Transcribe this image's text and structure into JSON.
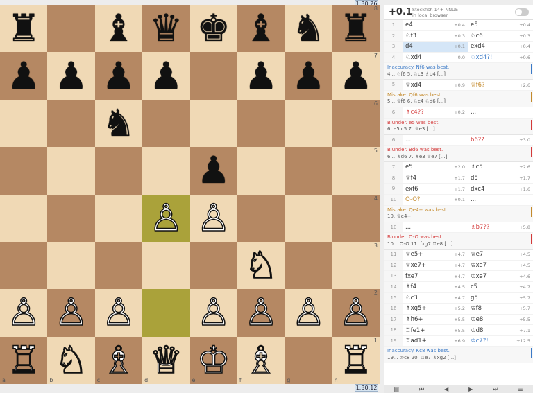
{
  "clocks": {
    "top": "1:30:26",
    "bottom": "1:30:12"
  },
  "board": {
    "rows": [
      [
        "♜",
        "",
        "♝",
        "♛",
        "♚",
        "♝",
        "♞",
        "♜"
      ],
      [
        "♟",
        "♟",
        "♟",
        "♟",
        "",
        "♟",
        "♟",
        "♟"
      ],
      [
        "",
        "",
        "♞",
        "",
        "",
        "",
        "",
        ""
      ],
      [
        "",
        "",
        "",
        "",
        "♟",
        "",
        "",
        ""
      ],
      [
        "",
        "",
        "",
        "♙",
        "♙",
        "",
        "",
        ""
      ],
      [
        "",
        "",
        "",
        "",
        "",
        "♘",
        "",
        ""
      ],
      [
        "♙",
        "♙",
        "♙",
        "",
        "♙",
        "♙",
        "♙",
        "♙"
      ],
      [
        "♖",
        "♘",
        "♗",
        "♕",
        "♔",
        "♗",
        "",
        "♖"
      ]
    ],
    "white_squares": [
      "d4",
      "e4",
      "f3",
      "a2",
      "b2",
      "c2",
      "e2",
      "f2",
      "g2",
      "h2",
      "a1",
      "b1",
      "c1",
      "d1",
      "e1",
      "f1",
      "h1"
    ],
    "highlights": [
      "d4",
      "d2"
    ],
    "ranks": [
      "8",
      "7",
      "6",
      "5",
      "4",
      "3",
      "2",
      "1"
    ],
    "files": [
      "a",
      "b",
      "c",
      "d",
      "e",
      "f",
      "g",
      "h"
    ]
  },
  "ceval": {
    "score": "+0.1",
    "engine": "Stockfish 14+ NNUE",
    "mode": "in local browser"
  },
  "moves": [
    {
      "type": "row",
      "n": "1",
      "w": "e4",
      "we": "+0.4",
      "b": "e5",
      "be": "+0.4"
    },
    {
      "type": "row",
      "n": "2",
      "w": "♘f3",
      "we": "+0.3",
      "b": "♘c6",
      "be": "+0.3"
    },
    {
      "type": "row",
      "n": "3",
      "w": "d4",
      "we": "+0.1",
      "b": "exd4",
      "be": "+0.4",
      "sel": "w"
    },
    {
      "type": "row",
      "n": "4",
      "w": "♘xd4",
      "we": "0.0",
      "b": "♘xd4?!",
      "be": "+0.6",
      "bc": "inaccuracy"
    },
    {
      "type": "comment",
      "kind": "inacc",
      "title": "Inaccuracy. Nf6 was best.",
      "line": "4... ♘f6 5. ♘c3 ♗b4 [...]"
    },
    {
      "type": "row",
      "n": "5",
      "w": "♕xd4",
      "we": "+0.9",
      "b": "♕f6?",
      "be": "+2.6",
      "bc": "mistake"
    },
    {
      "type": "comment",
      "kind": "mist",
      "title": "Mistake. Qf6 was best.",
      "line": "5... ♕f6 6. ♘c4 ♘d6 [...]"
    },
    {
      "type": "row",
      "n": "6",
      "w": "♗c4??",
      "we": "+0.2",
      "b": "...",
      "be": "",
      "wc": "blunder"
    },
    {
      "type": "comment",
      "kind": "blun",
      "title": "Blunder. e5 was best.",
      "line": "6. e5 c5 7. ♕e3 [...]"
    },
    {
      "type": "row",
      "n": "6",
      "w": "...",
      "we": "",
      "b": "b6??",
      "be": "+3.0",
      "bc": "blunder"
    },
    {
      "type": "comment",
      "kind": "blun",
      "title": "Blunder. Bd6 was best.",
      "line": "6... ♗d6 7. ♗e3 ♕e7 [...]"
    },
    {
      "type": "row",
      "n": "7",
      "w": "e5",
      "we": "+2.0",
      "b": "♗c5",
      "be": "+2.6"
    },
    {
      "type": "row",
      "n": "8",
      "w": "♕f4",
      "we": "+1.7",
      "b": "d5",
      "be": "+1.7"
    },
    {
      "type": "row",
      "n": "9",
      "w": "exf6",
      "we": "+1.7",
      "b": "dxc4",
      "be": "+1.6"
    },
    {
      "type": "row",
      "n": "10",
      "w": "O-O?",
      "we": "+0.1",
      "b": "...",
      "be": "",
      "wc": "mistake"
    },
    {
      "type": "comment",
      "kind": "mist",
      "title": "Mistake. Qe4+ was best.",
      "line": "10. ♕e4+"
    },
    {
      "type": "row",
      "n": "10",
      "w": "...",
      "we": "",
      "b": "♗b7??",
      "be": "+5.8",
      "bc": "blunder"
    },
    {
      "type": "comment",
      "kind": "blun",
      "title": "Blunder. O-O was best.",
      "line": "10... O-O 11. fxg7 ♖e8 [...]"
    },
    {
      "type": "row",
      "n": "11",
      "w": "♕e5+",
      "we": "+4.7",
      "b": "♕e7",
      "be": "+4.5"
    },
    {
      "type": "row",
      "n": "12",
      "w": "♕xe7+",
      "we": "+4.7",
      "b": "♔xe7",
      "be": "+4.5"
    },
    {
      "type": "row",
      "n": "13",
      "w": "fxe7",
      "we": "+4.7",
      "b": "♔xe7",
      "be": "+4.6"
    },
    {
      "type": "row",
      "n": "14",
      "w": "♗f4",
      "we": "+4.5",
      "b": "c5",
      "be": "+4.7"
    },
    {
      "type": "row",
      "n": "15",
      "w": "♘c3",
      "we": "+4.7",
      "b": "g5",
      "be": "+5.7"
    },
    {
      "type": "row",
      "n": "16",
      "w": "♗xg5+",
      "we": "+5.2",
      "b": "♔f8",
      "be": "+5.7"
    },
    {
      "type": "row",
      "n": "17",
      "w": "♗h6+",
      "we": "+5.5",
      "b": "♔e8",
      "be": "+5.5"
    },
    {
      "type": "row",
      "n": "18",
      "w": "♖fe1+",
      "we": "+5.5",
      "b": "♔d8",
      "be": "+7.1"
    },
    {
      "type": "row",
      "n": "19",
      "w": "♖ad1+",
      "we": "+6.9",
      "b": "♔c7?!",
      "be": "+12.5",
      "bc": "inaccuracy"
    },
    {
      "type": "comment",
      "kind": "inacc",
      "title": "Inaccuracy. Kc8 was best.",
      "line": "19... ♔c8 20. ♖e7 ♗xg2 [...]"
    }
  ],
  "controls": [
    "book-icon",
    "first-icon",
    "prev-icon",
    "next-icon",
    "last-icon",
    "menu-icon"
  ]
}
